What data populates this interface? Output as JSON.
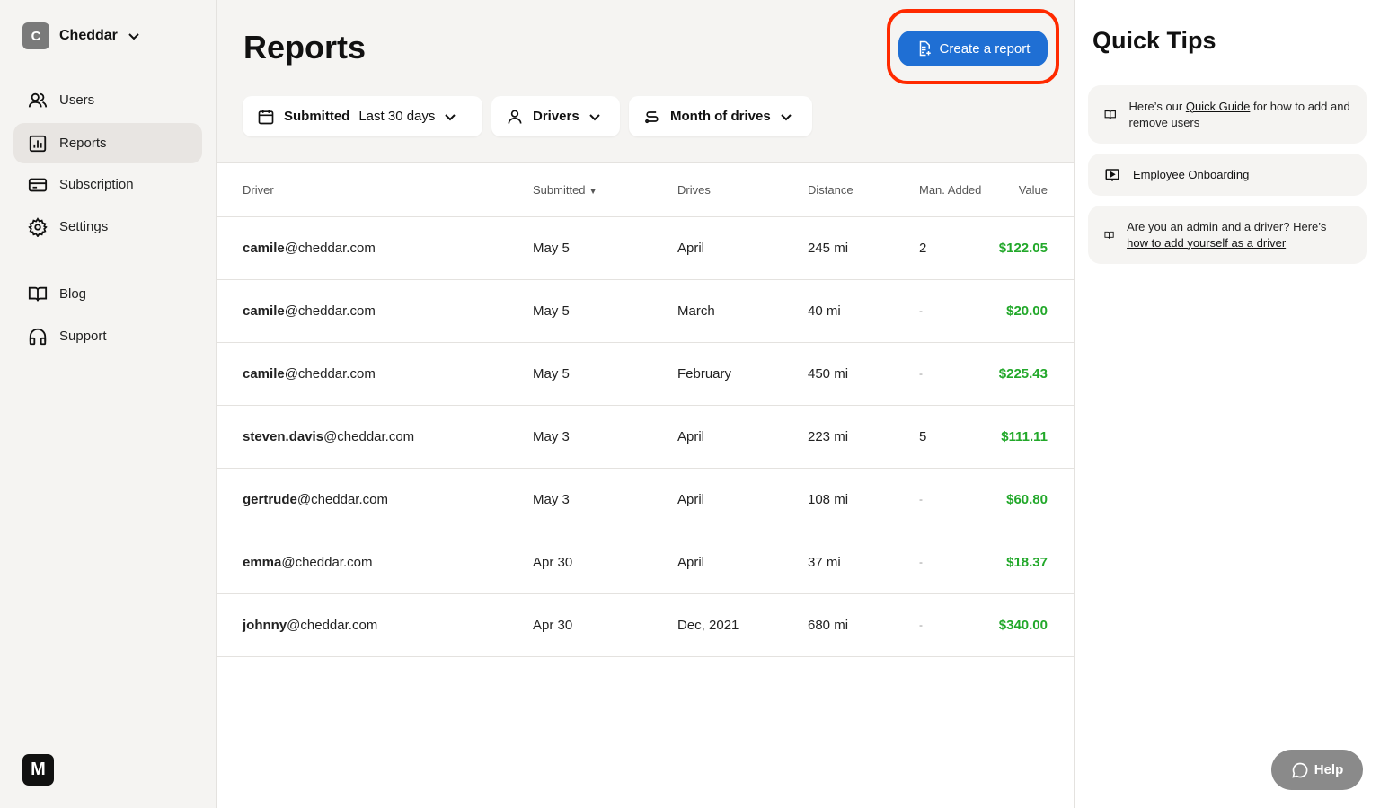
{
  "org": {
    "initial": "C",
    "name": "Cheddar"
  },
  "nav": [
    {
      "label": "Users"
    },
    {
      "label": "Reports"
    },
    {
      "label": "Subscription"
    },
    {
      "label": "Settings"
    },
    {
      "label": "Blog"
    },
    {
      "label": "Support"
    }
  ],
  "logo": "M",
  "page": {
    "title": "Reports",
    "create_label": "Create a report"
  },
  "filters": {
    "submitted_label": "Submitted",
    "submitted_value": "Last 30 days",
    "drivers": "Drivers",
    "month": "Month of drives"
  },
  "table": {
    "headers": [
      "Driver",
      "Submitted",
      "Drives",
      "Distance",
      "Man. Added",
      "Value"
    ],
    "rows": [
      {
        "user": "camile",
        "domain": "@cheddar.com",
        "submitted": "May 5",
        "drives": "April",
        "distance": "245 mi",
        "added": "2",
        "value": "$122.05"
      },
      {
        "user": "camile",
        "domain": "@cheddar.com",
        "submitted": "May 5",
        "drives": "March",
        "distance": "40 mi",
        "added": "-",
        "value": "$20.00"
      },
      {
        "user": "camile",
        "domain": "@cheddar.com",
        "submitted": "May 5",
        "drives": "February",
        "distance": "450 mi",
        "added": "-",
        "value": "$225.43"
      },
      {
        "user": "steven.davis",
        "domain": "@cheddar.com",
        "submitted": "May 3",
        "drives": "April",
        "distance": "223 mi",
        "added": "5",
        "value": "$111.11"
      },
      {
        "user": "gertrude",
        "domain": "@cheddar.com",
        "submitted": "May 3",
        "drives": "April",
        "distance": "108 mi",
        "added": "-",
        "value": "$60.80"
      },
      {
        "user": "emma",
        "domain": "@cheddar.com",
        "submitted": "Apr 30",
        "drives": "April",
        "distance": "37 mi",
        "added": "-",
        "value": "$18.37"
      },
      {
        "user": "johnny",
        "domain": "@cheddar.com",
        "submitted": "Apr 30",
        "drives": "Dec, 2021",
        "distance": "680 mi",
        "added": "-",
        "value": "$340.00"
      }
    ]
  },
  "tips": {
    "title": "Quick Tips",
    "t1": {
      "pre": "Here’s our ",
      "link": "Quick Guide",
      "post": " for how to add and remove users"
    },
    "t2": {
      "link": "Employee Onboarding"
    },
    "t3": {
      "pre": "Are you an admin and a driver? Here’s ",
      "link": "how to add yourself as a driver"
    }
  },
  "help": "Help"
}
